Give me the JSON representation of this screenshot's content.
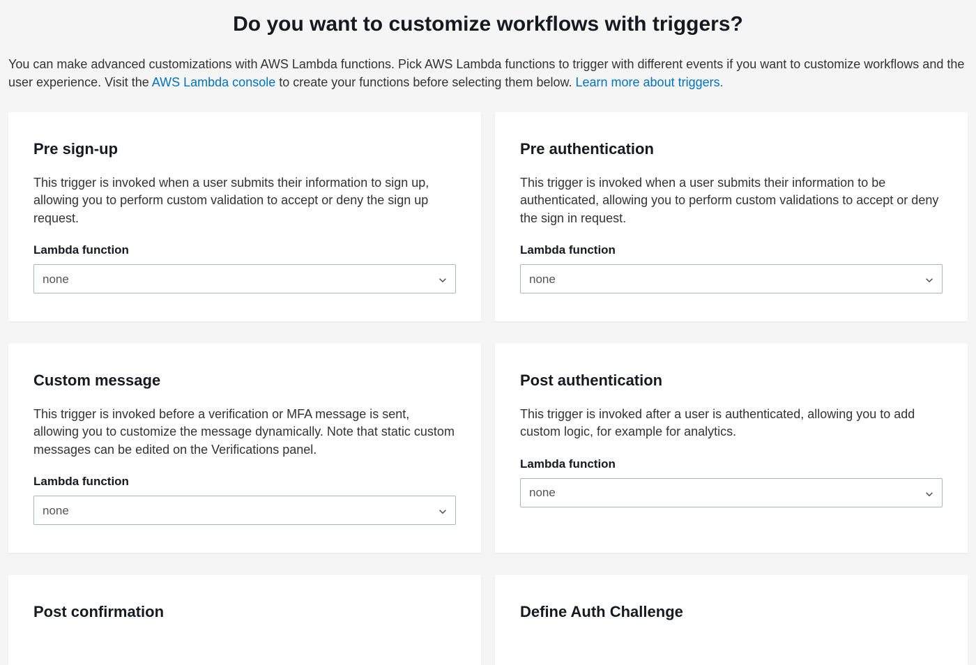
{
  "page": {
    "title": "Do you want to customize workflows with triggers?",
    "intro_part1": "You can make advanced customizations with AWS Lambda functions. Pick AWS Lambda functions to trigger with different events if you want to customize workflows and the user experience. Visit the ",
    "lambda_link_text": "AWS Lambda console",
    "intro_part2": " to create your functions before selecting them below. ",
    "learn_more_text": "Learn more about triggers."
  },
  "cards": {
    "pre_signup": {
      "title": "Pre sign-up",
      "description": "This trigger is invoked when a user submits their information to sign up, allowing you to perform custom validation to accept or deny the sign up request.",
      "field_label": "Lambda function",
      "select_value": "none"
    },
    "pre_auth": {
      "title": "Pre authentication",
      "description": "This trigger is invoked when a user submits their information to be authenticated, allowing you to perform custom validations to accept or deny the sign in request.",
      "field_label": "Lambda function",
      "select_value": "none"
    },
    "custom_message": {
      "title": "Custom message",
      "description": "This trigger is invoked before a verification or MFA message is sent, allowing you to customize the message dynamically. Note that static custom messages can be edited on the Verifications panel.",
      "field_label": "Lambda function",
      "select_value": "none"
    },
    "post_auth": {
      "title": "Post authentication",
      "description": "This trigger is invoked after a user is authenticated, allowing you to add custom logic, for example for analytics.",
      "field_label": "Lambda function",
      "select_value": "none"
    },
    "post_confirm": {
      "title": "Post confirmation"
    },
    "define_auth": {
      "title": "Define Auth Challenge"
    }
  }
}
